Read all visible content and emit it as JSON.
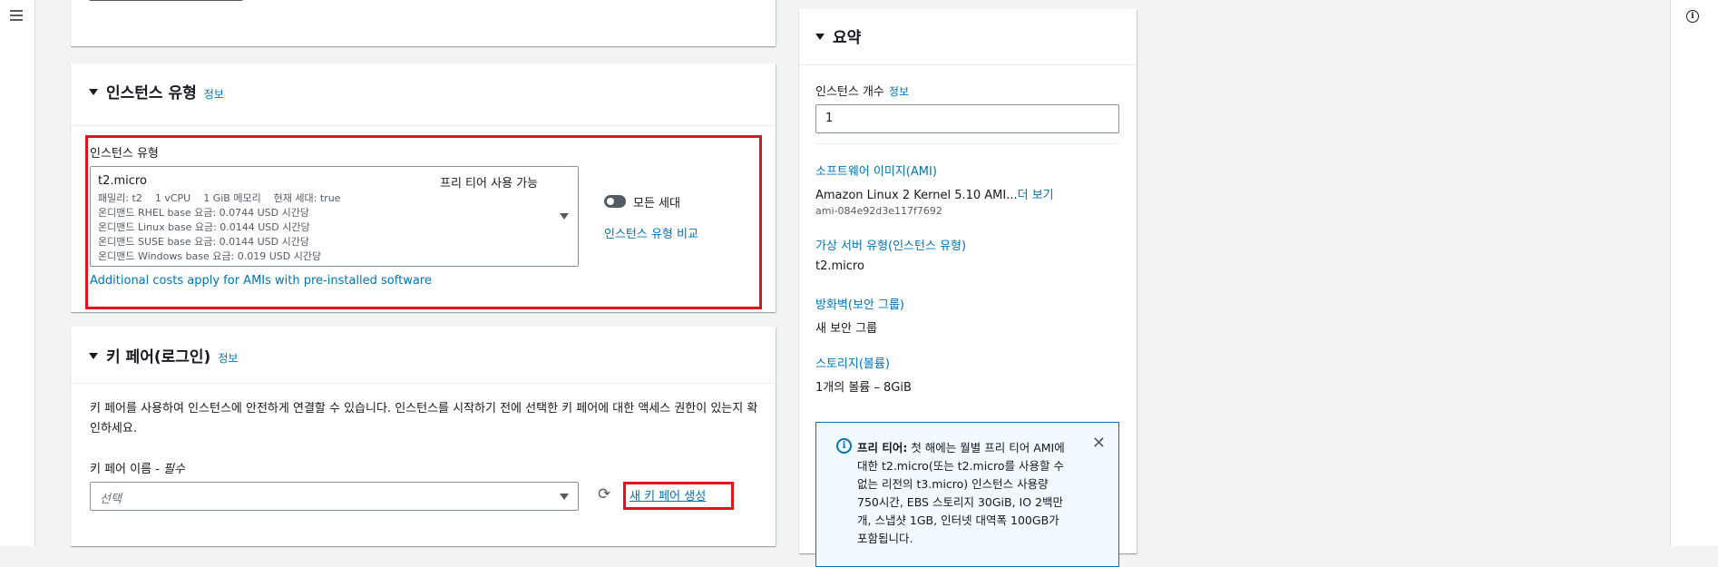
{
  "instance_type_section": {
    "title": "인스턴스 유형",
    "info": "정보",
    "field_label": "인스턴스 유형",
    "selected_type": "t2.micro",
    "free_tier": "프리 티어 사용 가능",
    "details": [
      "패밀리: t2    1 vCPU    1 GiB 메모리    현재 세대: true",
      "온디맨드 RHEL base 요금: 0.0744 USD 시간당",
      "온디맨드 Linux base 요금: 0.0144 USD 시간당",
      "온디맨드 SUSE base 요금: 0.0144 USD 시간당",
      "온디맨드 Windows base 요금: 0.019 USD 시간당"
    ],
    "all_generations": "모든 세대",
    "compare_link": "인스턴스 유형 비교",
    "additional_costs": "Additional costs apply for AMIs with pre-installed software"
  },
  "key_pair_section": {
    "title": "키 페어(로그인)",
    "info": "정보",
    "description": "키 페어를 사용하여 인스턴스에 안전하게 연결할 수 있습니다. 인스턴스를 시작하기 전에 선택한 키 페어에 대한 액세스 권한이 있는지 확인하세요.",
    "name_label": "키 페어 이름 - ",
    "required": "필수",
    "placeholder": "선택",
    "create_link": "새 키 페어 생성"
  },
  "summary": {
    "title": "요약",
    "count_label": "인스턴스 개수",
    "count_info": "정보",
    "count_value": "1",
    "software_image_label": "소프트웨어 이미지(AMI)",
    "ami_name": "Amazon Linux 2 Kernel 5.10 AMI...",
    "ami_more": "더 보기",
    "ami_id": "ami-084e92d3e117f7692",
    "virtual_server_label": "가상 서버 유형(인스턴스 유형)",
    "virtual_server_value": "t2.micro",
    "firewall_label": "방화벽(보안 그룹)",
    "firewall_value": "새 보안 그룹",
    "storage_label": "스토리지(볼륨)",
    "storage_value": "1개의 볼륨 – 8GiB",
    "free_tier_bold": "프리 티어:",
    "free_tier_text": " 첫 해에는 월별 프리 티어 AMI에 대한 t2.micro(또는 t2.micro를 사용할 수 없는 리전의 t3.micro) 인스턴스 사용량 750시간, EBS 스토리지 30GiB, IO 2백만 개, 스냅샷 1GB, 인터넷 대역폭 100GB가 포함됩니다."
  }
}
